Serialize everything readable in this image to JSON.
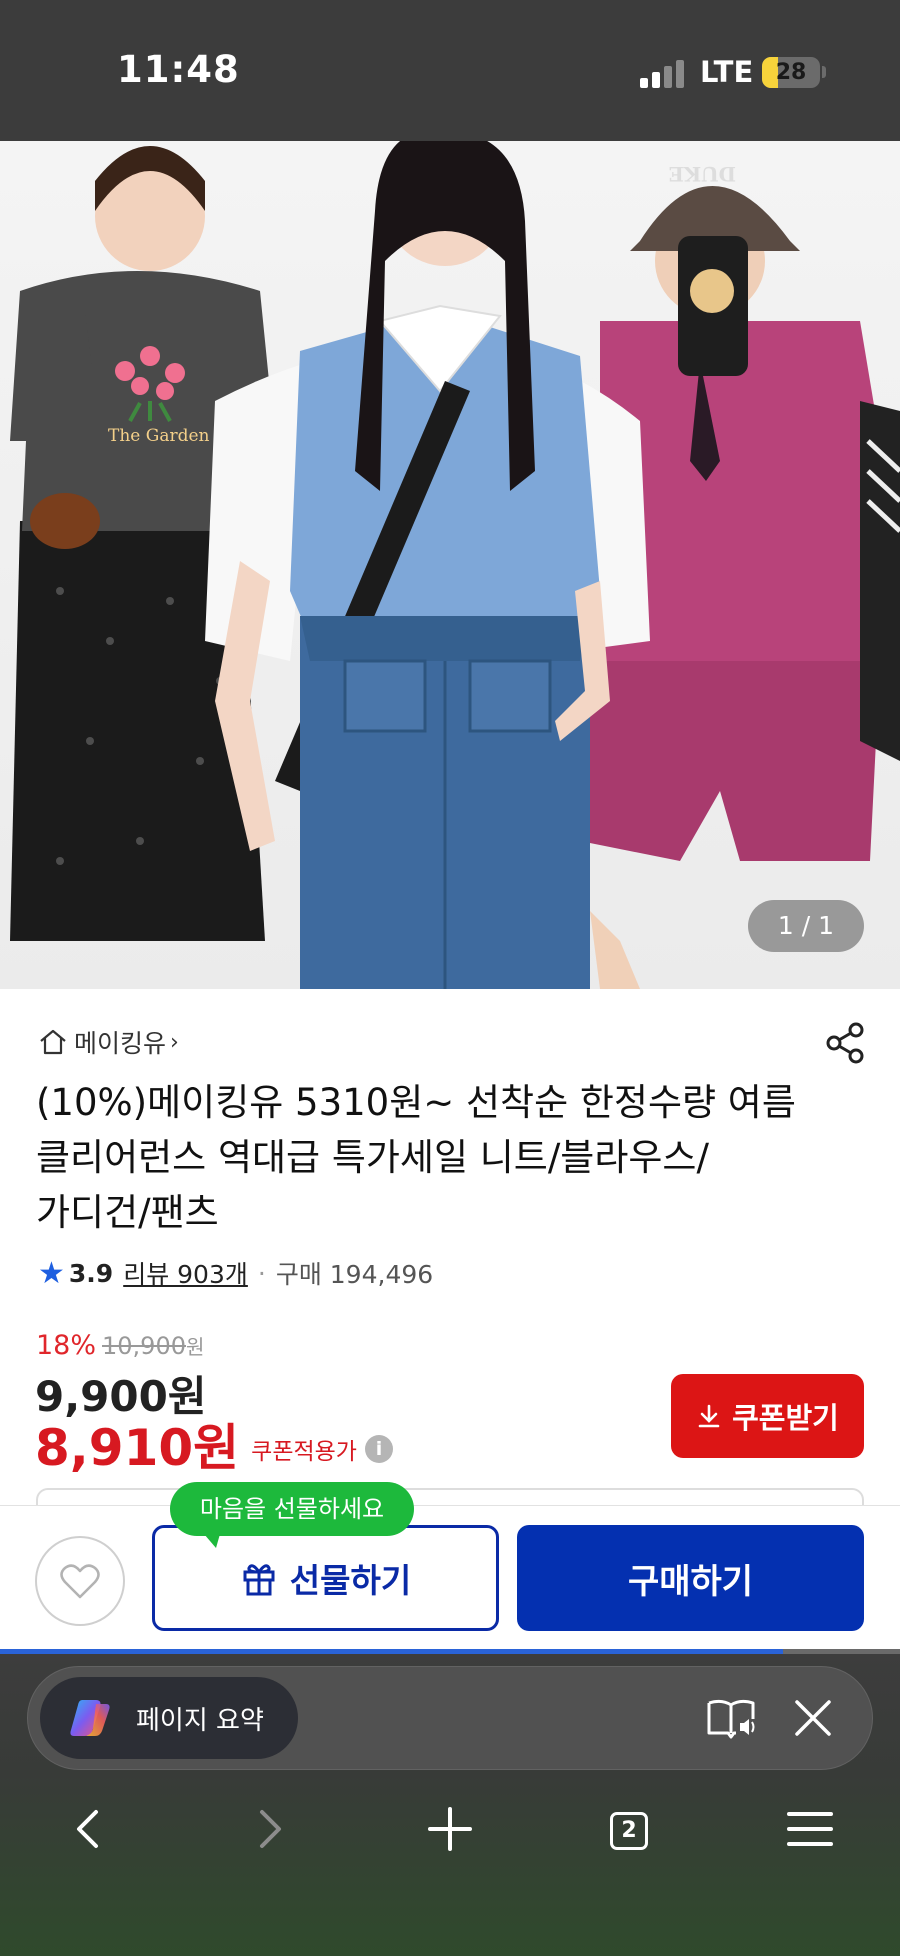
{
  "status_bar": {
    "time": "11:48",
    "network": "LTE",
    "battery": "28",
    "battery_level_percent": 28,
    "battery_color": "#f7d33b"
  },
  "gallery": {
    "shirt_print": "The Garden",
    "cap_print": "DUKE",
    "counter": "1 / 1"
  },
  "product": {
    "store_name": "메이킹유",
    "title": "(10%)메이킹유 5310원~ 선착순 한정수량 여름 클리어런스 역대급 특가세일 니트/블라우스/가디건/팬츠",
    "rating": "3.9",
    "reviews": "리뷰 903개",
    "purchases": "구매 194,496",
    "discount_rate": "18%",
    "original_price": "10,900",
    "original_price_unit": "원",
    "sale_price": "9,900원",
    "coupon_price": "8,910원",
    "coupon_price_label": "쿠폰적용가",
    "coupon_button": "쿠폰받기",
    "accent_color": "#d71921"
  },
  "actions": {
    "gift_tooltip": "마음을 선물하세요",
    "gift_button": "선물하기",
    "buy_button": "구매하기",
    "brand_color": "#0430b0",
    "page_load_percent": 87
  },
  "browser": {
    "summary_label": "페이지 요약",
    "tab_count": "2"
  }
}
